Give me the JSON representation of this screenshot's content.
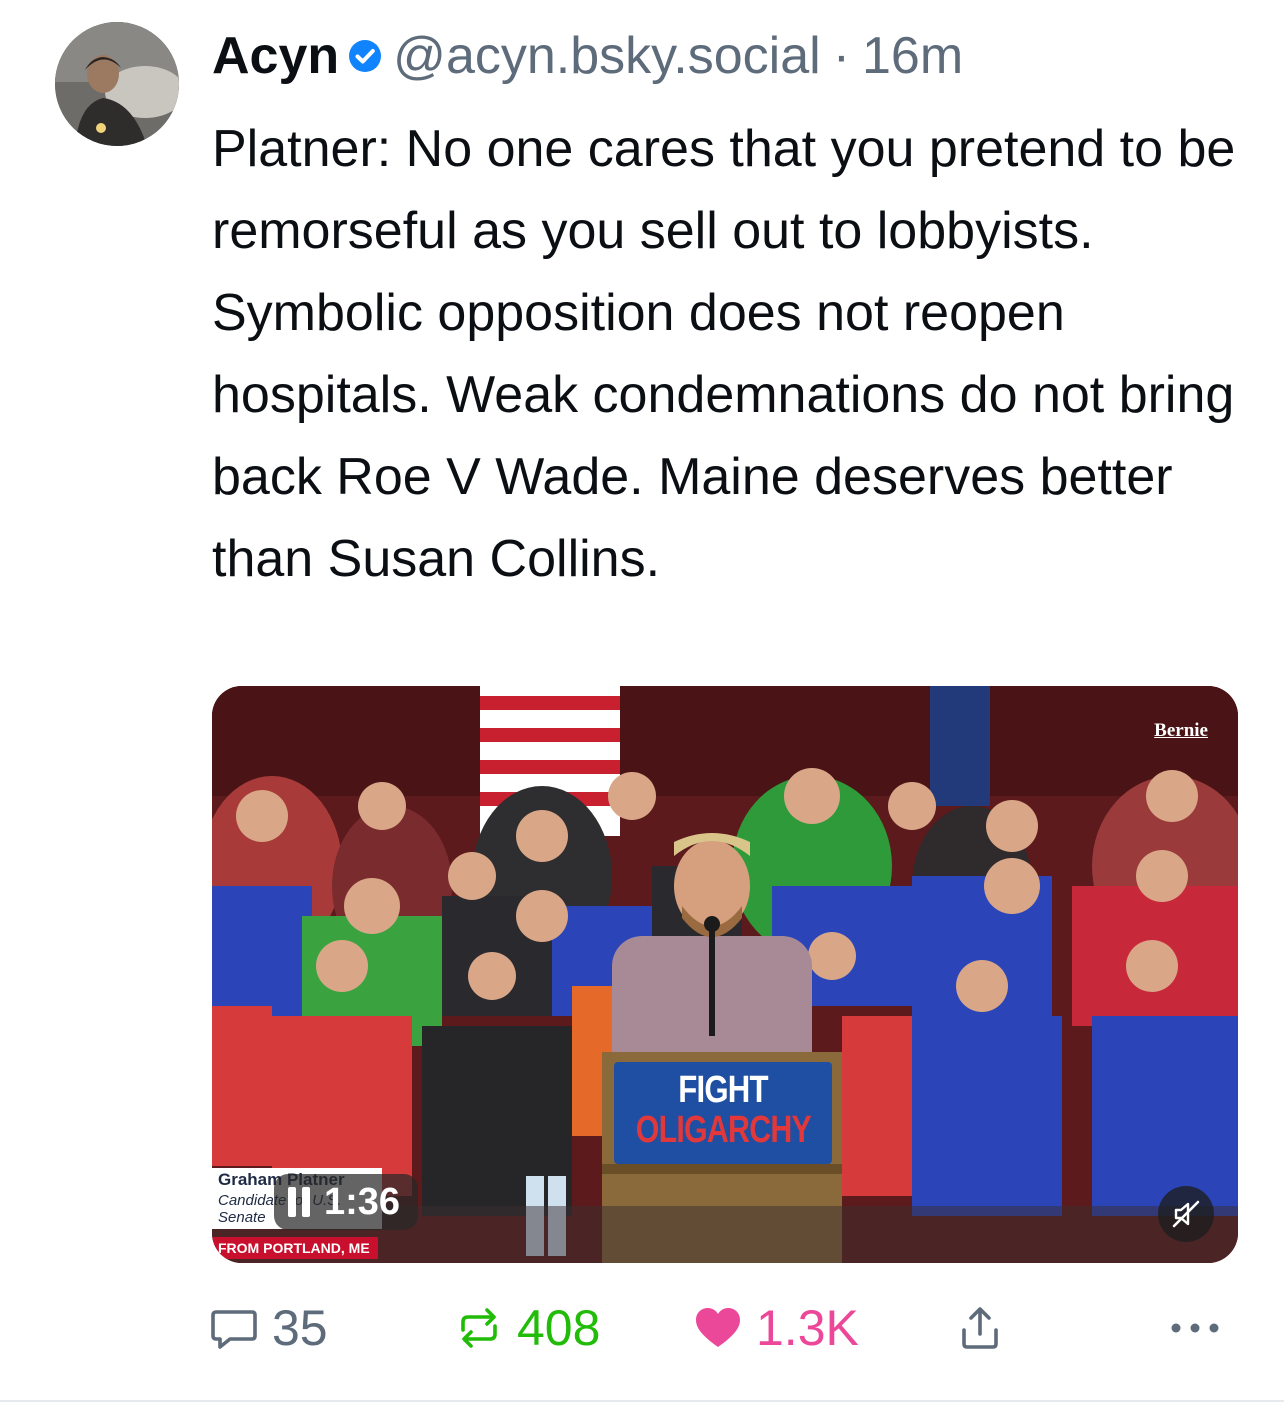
{
  "post": {
    "author_name": "Acyn",
    "handle": "@acyn.bsky.social",
    "separator": "·",
    "time": "16m",
    "text": "Platner: No one cares that you pretend to be remorseful as you sell out to lobbyists. Symbolic opposition does not reopen hospitals. Weak condemnations do not bring back Roe V Wade. Maine deserves better than Susan Collins."
  },
  "icons": {
    "verified": "verified-check-icon",
    "pause": "pause-icon",
    "mute": "muted-speaker-icon",
    "reply": "speech-bubble-icon",
    "repost": "repost-arrows-icon",
    "like": "heart-icon",
    "share": "share-upload-icon",
    "more": "ellipsis-icon"
  },
  "video": {
    "watermark": "Bernie",
    "lower_third_name": "Graham Platner",
    "lower_third_role": "Candidate for U.S. Senate",
    "lower_third_location": "FROM PORTLAND, ME",
    "timer": "1:36",
    "sign_line1": "FIGHT",
    "sign_line2": "OLIGARCHY"
  },
  "counts": {
    "replies": "35",
    "reposts": "408",
    "likes": "1.3K"
  },
  "colors": {
    "text": "#0b0f14",
    "muted": "#5d6b7a",
    "verified": "#1083fe",
    "repost": "#20bc07",
    "like": "#ec4899"
  }
}
